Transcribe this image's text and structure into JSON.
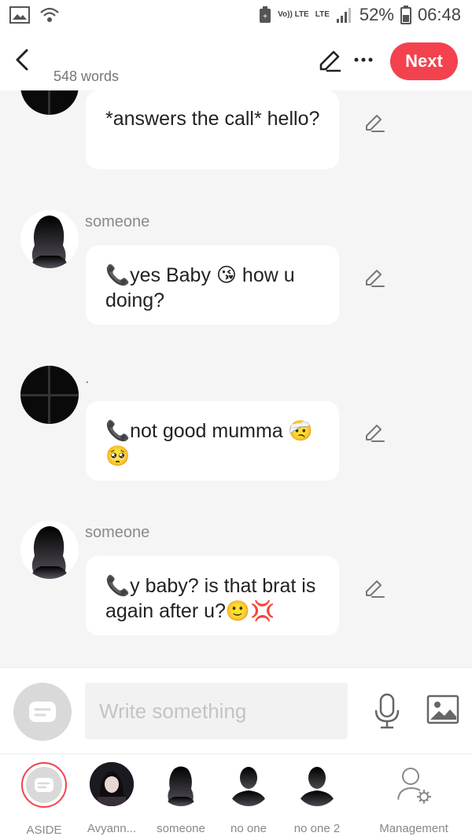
{
  "status_bar": {
    "volte": "Vo)) LTE",
    "network": "LTE",
    "battery": "52%",
    "time": "06:48"
  },
  "header": {
    "word_count": "548 words",
    "next_label": "Next"
  },
  "messages": [
    {
      "sender": "",
      "text": "*answers the call* hello?",
      "avatar": "dark"
    },
    {
      "sender": "someone",
      "text": "📞yes Baby 😘 how u doing?",
      "avatar": "silhouette"
    },
    {
      "sender": ".",
      "text": "📞not good mumma 🤕🥺",
      "avatar": "dark"
    },
    {
      "sender": "someone",
      "text": "📞y baby? is that brat is again after u?🙂💢",
      "avatar": "silhouette"
    }
  ],
  "composer": {
    "placeholder": "Write something"
  },
  "tabs": [
    {
      "label": "ASIDE"
    },
    {
      "label": "Avyann..."
    },
    {
      "label": "someone"
    },
    {
      "label": "no one"
    },
    {
      "label": "no one 2"
    },
    {
      "label": "Management"
    }
  ],
  "colors": {
    "accent": "#f3424e",
    "bubble": "#ffffff",
    "background": "#f5f5f5"
  }
}
